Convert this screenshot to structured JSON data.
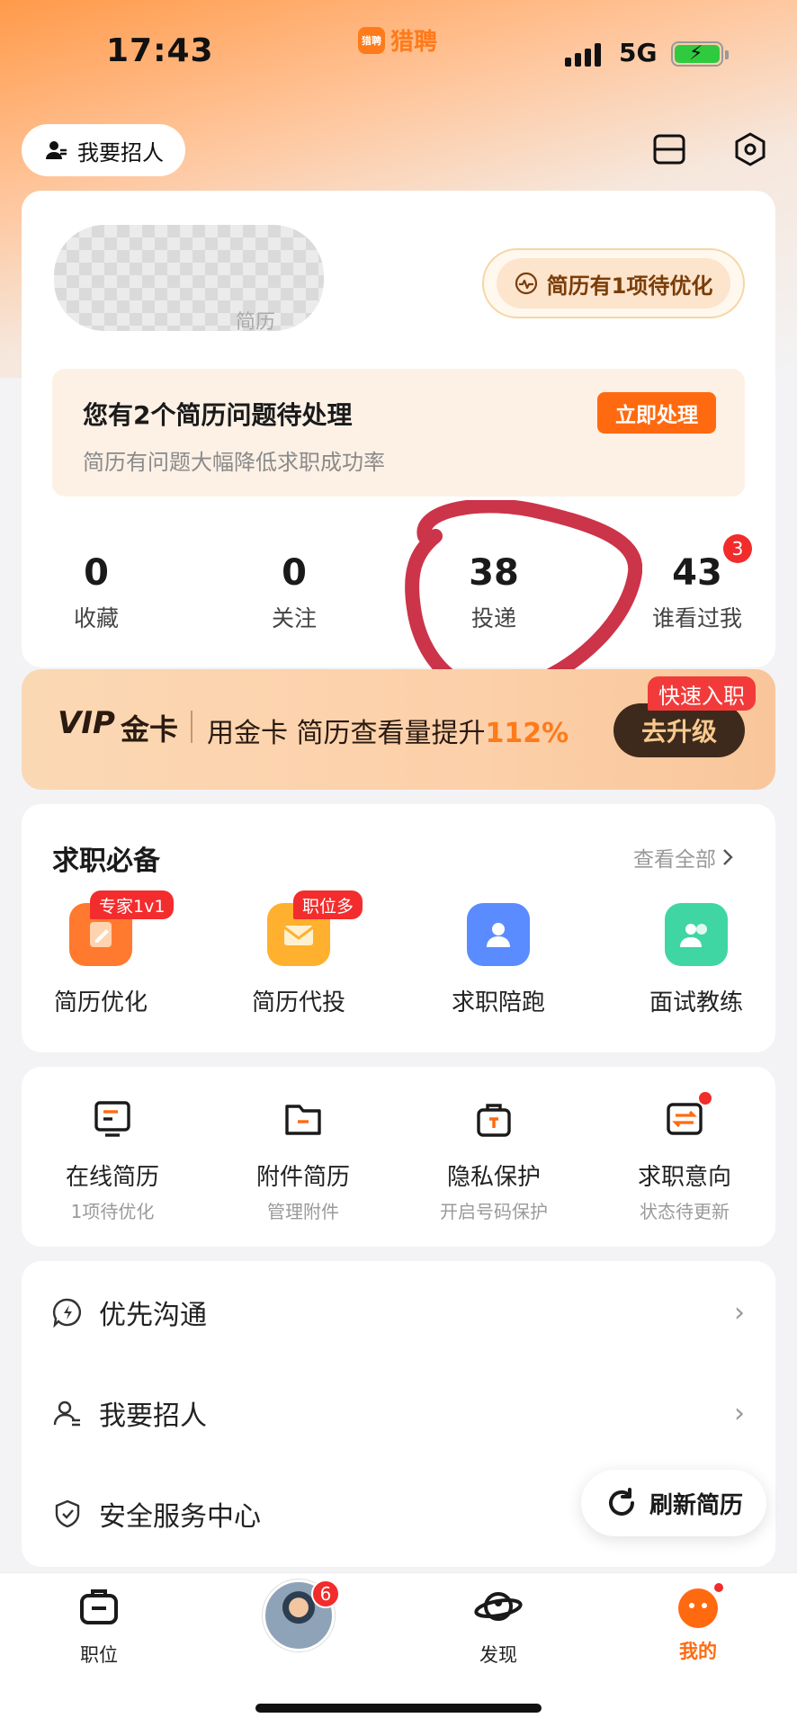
{
  "status_bar": {
    "time": "17:43",
    "brand": "猎聘",
    "brand_logo_text": "猎聘",
    "network": "5G"
  },
  "header": {
    "recruit_button": "我要招人"
  },
  "profile": {
    "blurred_subtitle": "简历",
    "optimize_pill": "简历有1项待优化"
  },
  "issue": {
    "title": "您有2个简历问题待处理",
    "subtitle": "简历有问题大幅降低求职成功率",
    "action": "立即处理"
  },
  "stats": [
    {
      "value": "0",
      "label": "收藏"
    },
    {
      "value": "0",
      "label": "关注"
    },
    {
      "value": "38",
      "label": "投递"
    },
    {
      "value": "43",
      "label": "谁看过我"
    }
  ],
  "stats_badge": "3",
  "vip": {
    "logo": "VIP",
    "card": "金卡",
    "text": "用金卡 简历查看量提升",
    "percent": "112%",
    "upgrade": "去升级",
    "tag": "快速入职"
  },
  "tools": {
    "title": "求职必备",
    "more": "查看全部",
    "items": [
      {
        "label": "简历优化",
        "tag": "专家1v1",
        "icon": "resume-edit-icon",
        "color": "#ff7a2e"
      },
      {
        "label": "简历代投",
        "tag": "职位多",
        "icon": "envelope-icon",
        "color": "#ffb02e"
      },
      {
        "label": "求职陪跑",
        "tag": "",
        "icon": "person-icon",
        "color": "#5b8cff"
      },
      {
        "label": "面试教练",
        "tag": "",
        "icon": "people-icon",
        "color": "#3fd6a3"
      }
    ]
  },
  "resume": [
    {
      "label": "在线简历",
      "sub": "1项待优化",
      "icon": "monitor-resume-icon"
    },
    {
      "label": "附件简历",
      "sub": "管理附件",
      "icon": "folder-icon"
    },
    {
      "label": "隐私保护",
      "sub": "开启号码保护",
      "icon": "privacy-bag-icon"
    },
    {
      "label": "求职意向",
      "sub": "状态待更新",
      "icon": "intent-switch-icon"
    }
  ],
  "list": [
    {
      "label": "优先沟通",
      "icon": "lightning-chat-icon"
    },
    {
      "label": "我要招人",
      "icon": "recruit-user-icon"
    },
    {
      "label": "安全服务中心",
      "icon": "shield-check-icon"
    }
  ],
  "refresh_button": "刷新简历",
  "bottom_nav": [
    {
      "label": "职位",
      "icon": "briefcase-icon"
    },
    {
      "label": "",
      "icon": "avatar-icon",
      "badge": "6"
    },
    {
      "label": "发现",
      "icon": "planet-icon"
    },
    {
      "label": "我的",
      "icon": "mine-face-icon"
    }
  ]
}
